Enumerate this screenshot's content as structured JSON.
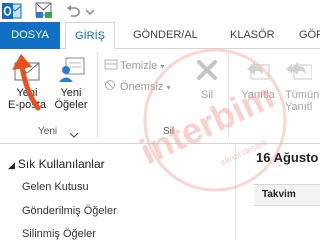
{
  "tabs": {
    "file": "DOSYA",
    "home": "GİRİŞ",
    "send_receive": "GÖNDER/AL",
    "folder": "KLASÖR",
    "view": "GÖR"
  },
  "ribbon": {
    "new_email": [
      "Yeni",
      "E-posta"
    ],
    "new_items": [
      "Yeni",
      "Öğeler"
    ],
    "new_group_label": "Yeni",
    "clean_up": "Temizle",
    "junk": "Önemsiz",
    "delete": "Sil",
    "delete_group_label": "Sil",
    "reply": "Yanıtla",
    "reply_all": [
      "Tümün",
      "Yanıtl"
    ]
  },
  "folder_pane": {
    "favorites_header": "Sık Kullanılanlar",
    "items": [
      "Gelen Kutusu",
      "Gönderilmiş Öğeler",
      "Silinmiş Öğeler"
    ]
  },
  "calendar": {
    "date": "16 Ağusto",
    "column_header": "Takvim"
  },
  "watermark": {
    "brand": "interbim",
    "tagline": "sanal destek"
  },
  "colors": {
    "file_tab": "#0f70c4",
    "accent_blue": "#0f6cbd",
    "arrow": "#e8501e",
    "watermark": "#f1a596"
  }
}
